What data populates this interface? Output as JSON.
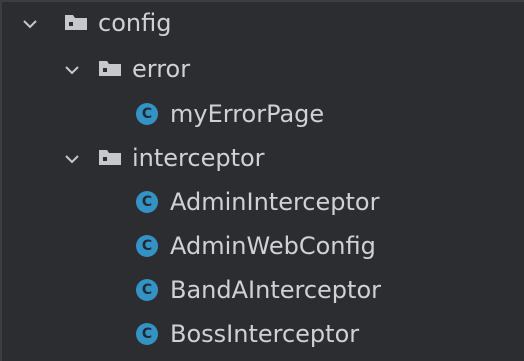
{
  "project_tree": {
    "items": [
      {
        "label": "config",
        "kind": "folder",
        "expanded": true,
        "icon": "folder-icon"
      },
      {
        "label": "error",
        "kind": "folder",
        "expanded": true,
        "icon": "folder-icon"
      },
      {
        "label": "myErrorPage",
        "kind": "class",
        "icon": "class-icon",
        "icon_glyph": "C"
      },
      {
        "label": "interceptor",
        "kind": "folder",
        "expanded": true,
        "icon": "folder-icon"
      },
      {
        "label": "AdminInterceptor",
        "kind": "class",
        "icon": "class-icon",
        "icon_glyph": "C"
      },
      {
        "label": "AdminWebConfig",
        "kind": "class",
        "icon": "class-icon",
        "icon_glyph": "C"
      },
      {
        "label": "BandAInterceptor",
        "kind": "class",
        "icon": "class-icon",
        "icon_glyph": "C"
      },
      {
        "label": "BossInterceptor",
        "kind": "class",
        "icon": "class-icon",
        "icon_glyph": "C"
      }
    ]
  },
  "colors": {
    "background": "#2b2d30",
    "text": "#cfd1d4",
    "folder": "#c6c8cc",
    "class_icon": "#3592c4"
  }
}
